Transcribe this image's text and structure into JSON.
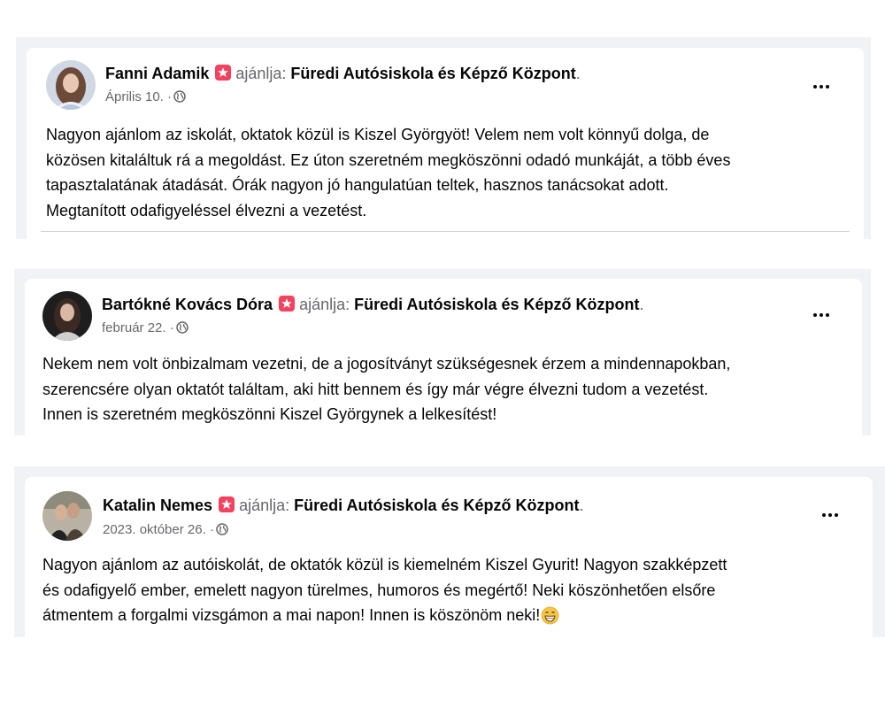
{
  "posts": [
    {
      "author": "Fanni Adamik",
      "verb": "ajánlja:",
      "page": "Füredi Autósiskola és Képző Központ",
      "punct": ".",
      "date": "Április 10.",
      "separator": "·",
      "lines": [
        "Nagyon ajánlom az iskolát, oktatok közül is  Kiszel Györgyöt! Velem nem volt könnyű dolga, de",
        "közösen kitaláltuk rá a megoldást. Ez úton szeretném megköszönni odadó munkáját, a több éves",
        "tapasztalatának átadását. Órák nagyon jó hangulatúan teltek, hasznos tanácsokat adott.",
        "Megtanított odafigyeléssel élvezni a vezetést."
      ]
    },
    {
      "author": "Bartókné Kovács Dóra",
      "verb": "ajánlja:",
      "page": "Füredi Autósiskola és Képző Központ",
      "punct": ".",
      "date": "február 22.",
      "separator": "·",
      "lines": [
        "Nekem nem volt önbizalmam vezetni, de a jogosítványt szükségesnek érzem a mindennapokban,",
        "szerencsére olyan oktatót találtam, aki hitt bennem és így már végre élvezni tudom a vezetést.",
        "Innen is szeretném megköszönni Kiszel Györgynek a lelkesítést!"
      ]
    },
    {
      "author": "Katalin Nemes",
      "verb": "ajánlja:",
      "page": "Füredi Autósiskola és Képző Központ",
      "punct": ".",
      "date": "2023. október 26.",
      "separator": "·",
      "lines": [
        "Nagyon ajánlom az autóiskolát, de oktatók közül is kiemelném Kiszel Gyurit! Nagyon szakképzett",
        "és odafigyelő ember, emelett nagyon türelmes, humoros és megértő! Neki köszönhetően elsőre",
        "átmentem a forgalmi vizsgámon a mai napon! Innen is köszönöm neki!"
      ]
    }
  ],
  "colors": {
    "background": "#f0f2f5",
    "card": "#ffffff",
    "recommend_badge": "#f3425f",
    "secondary_text": "#65676b",
    "primary_text": "#050505"
  },
  "icons": {
    "recommend": "recommend-star-icon",
    "privacy": "globe-icon",
    "more": "more-options-icon",
    "emoji": "grinning-emoji-icon"
  }
}
